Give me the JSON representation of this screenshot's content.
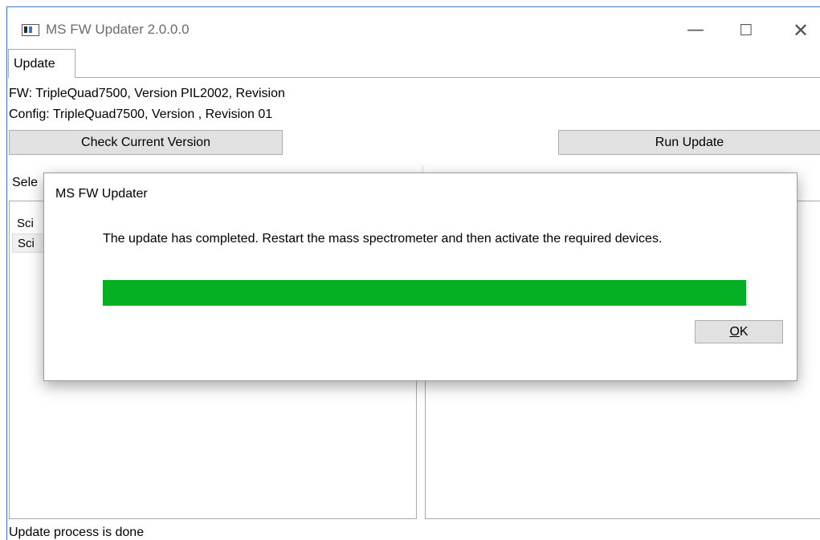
{
  "window": {
    "title": "MS FW Updater 2.0.0.0",
    "controls": {
      "minimize": "—",
      "maximize": "☐",
      "close": "✕"
    }
  },
  "tabs": [
    {
      "label": "Update",
      "active": true
    }
  ],
  "info": {
    "fw": "FW: TripleQuad7500, Version PIL2002, Revision",
    "config": "Config: TripleQuad7500, Version , Revision 01"
  },
  "buttons": {
    "check_version": "Check Current Version",
    "run_update": "Run Update"
  },
  "sections": {
    "select_updates_label": "Sele",
    "update_details_label": ""
  },
  "updates_list": {
    "items": [
      {
        "label": "Sci"
      },
      {
        "label": "Sci"
      }
    ]
  },
  "status": {
    "text": "Update process is done"
  },
  "dialog": {
    "title": "MS FW Updater",
    "message": "The update has completed. Restart the mass spectrometer and then activate the required devices.",
    "progress_percent": 100,
    "progress_color": "#06b025",
    "ok_label_underlined": "O",
    "ok_label_rest": "K"
  }
}
